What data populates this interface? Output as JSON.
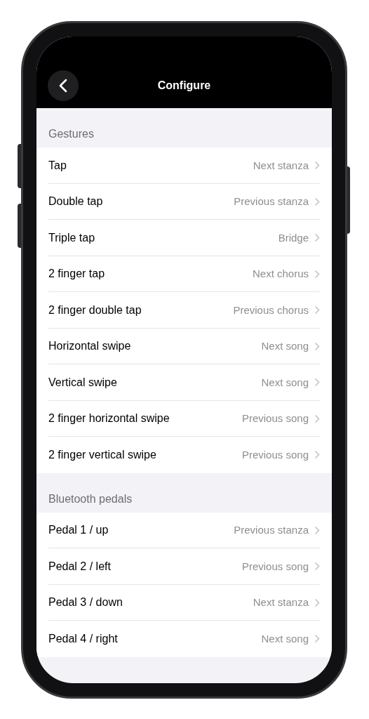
{
  "header": {
    "title": "Configure"
  },
  "sections": [
    {
      "title": "Gestures",
      "rows": [
        {
          "label": "Tap",
          "value": "Next stanza"
        },
        {
          "label": "Double tap",
          "value": "Previous stanza"
        },
        {
          "label": "Triple tap",
          "value": "Bridge"
        },
        {
          "label": "2 finger tap",
          "value": "Next chorus"
        },
        {
          "label": "2 finger double tap",
          "value": "Previous chorus"
        },
        {
          "label": "Horizontal swipe",
          "value": "Next song"
        },
        {
          "label": "Vertical swipe",
          "value": "Next song"
        },
        {
          "label": "2 finger horizontal swipe",
          "value": "Previous song"
        },
        {
          "label": "2 finger vertical swipe",
          "value": "Previous song"
        }
      ]
    },
    {
      "title": "Bluetooth pedals",
      "rows": [
        {
          "label": "Pedal 1 / up",
          "value": "Previous stanza"
        },
        {
          "label": "Pedal 2 / left",
          "value": "Previous song"
        },
        {
          "label": "Pedal 3 / down",
          "value": "Next stanza"
        },
        {
          "label": "Pedal 4 / right",
          "value": "Next song"
        }
      ]
    }
  ]
}
